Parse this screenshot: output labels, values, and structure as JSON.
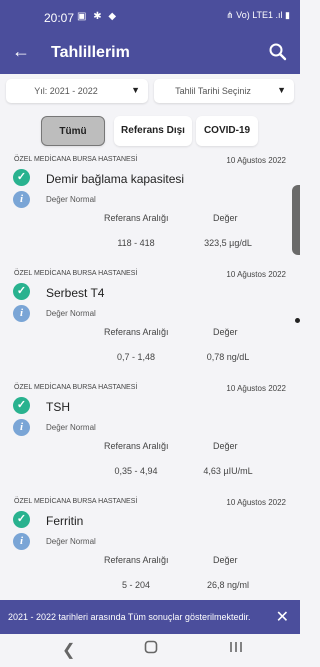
{
  "status_bar": {
    "time": "20:07",
    "left_icons": "▣ ✱ ◆",
    "right_icons": "⋔ Vo) LTE1 .ıl ▮"
  },
  "app_bar": {
    "title": "Tahlillerim"
  },
  "filters": {
    "year_label": "Yıl: 2021 - 2022",
    "date_label": "Tahlil Tarihi Seçiniz"
  },
  "tabs": [
    {
      "label": "Tümü",
      "active": true
    },
    {
      "label": "Referans Dışı",
      "active": false
    },
    {
      "label": "COVID-19",
      "active": false
    }
  ],
  "column_headers": {
    "reference": "Referans Aralığı",
    "value": "Değer"
  },
  "results": [
    {
      "hospital": "ÖZEL MEDİCANA BURSA HASTANESİ",
      "date": "10 Ağustos 2022",
      "test": "Demir bağlama kapasitesi",
      "status": "Değer Normal",
      "reference": "118 - 418",
      "value": "323,5 µg/dL"
    },
    {
      "hospital": "ÖZEL MEDİCANA BURSA HASTANESİ",
      "date": "10 Ağustos 2022",
      "test": "Serbest T4",
      "status": "Değer Normal",
      "reference": "0,7 - 1,48",
      "value": "0,78 ng/dL"
    },
    {
      "hospital": "ÖZEL MEDİCANA BURSA HASTANESİ",
      "date": "10 Ağustos 2022",
      "test": "TSH",
      "status": "Değer Normal",
      "reference": "0,35 - 4,94",
      "value": "4,63 µIU/mL"
    },
    {
      "hospital": "ÖZEL MEDİCANA BURSA HASTANESİ",
      "date": "10 Ağustos 2022",
      "test": "Ferritin",
      "status": "Değer Normal",
      "reference": "5 - 204",
      "value": "26,8 ng/ml"
    }
  ],
  "banner": {
    "text": "2021 - 2022 tarihleri arasında Tüm sonuçlar gösterilmektedir."
  },
  "colors": {
    "primary": "#4b4e9c",
    "success": "#29b28f",
    "info": "#7aa5d6"
  }
}
